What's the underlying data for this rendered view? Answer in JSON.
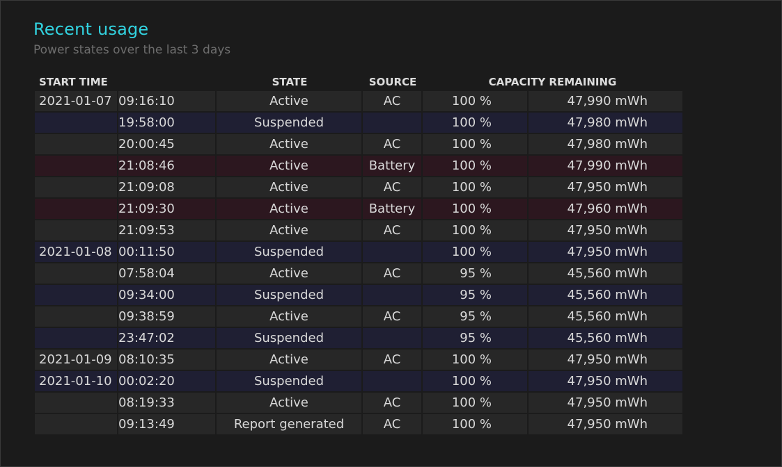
{
  "header": {
    "title": "Recent usage",
    "subtitle": "Power states over the last 3 days"
  },
  "columns": {
    "start_time": "START TIME",
    "state": "STATE",
    "source": "SOURCE",
    "capacity": "CAPACITY REMAINING"
  },
  "colors": {
    "title": "#32d3e0",
    "row_ac": "#272727",
    "row_suspended": "#1f1f33",
    "row_battery": "#2c171f"
  },
  "rows": [
    {
      "date": "2021-01-07",
      "time": "09:16:10",
      "state": "Active",
      "source": "AC",
      "percent": "100 %",
      "mwh": "47,990 mWh"
    },
    {
      "date": "",
      "time": "19:58:00",
      "state": "Suspended",
      "source": "",
      "percent": "100 %",
      "mwh": "47,980 mWh"
    },
    {
      "date": "",
      "time": "20:00:45",
      "state": "Active",
      "source": "AC",
      "percent": "100 %",
      "mwh": "47,980 mWh"
    },
    {
      "date": "",
      "time": "21:08:46",
      "state": "Active",
      "source": "Battery",
      "percent": "100 %",
      "mwh": "47,990 mWh"
    },
    {
      "date": "",
      "time": "21:09:08",
      "state": "Active",
      "source": "AC",
      "percent": "100 %",
      "mwh": "47,950 mWh"
    },
    {
      "date": "",
      "time": "21:09:30",
      "state": "Active",
      "source": "Battery",
      "percent": "100 %",
      "mwh": "47,960 mWh"
    },
    {
      "date": "",
      "time": "21:09:53",
      "state": "Active",
      "source": "AC",
      "percent": "100 %",
      "mwh": "47,950 mWh"
    },
    {
      "date": "2021-01-08",
      "time": "00:11:50",
      "state": "Suspended",
      "source": "",
      "percent": "100 %",
      "mwh": "47,950 mWh"
    },
    {
      "date": "",
      "time": "07:58:04",
      "state": "Active",
      "source": "AC",
      "percent": "95 %",
      "mwh": "45,560 mWh"
    },
    {
      "date": "",
      "time": "09:34:00",
      "state": "Suspended",
      "source": "",
      "percent": "95 %",
      "mwh": "45,560 mWh"
    },
    {
      "date": "",
      "time": "09:38:59",
      "state": "Active",
      "source": "AC",
      "percent": "95 %",
      "mwh": "45,560 mWh"
    },
    {
      "date": "",
      "time": "23:47:02",
      "state": "Suspended",
      "source": "",
      "percent": "95 %",
      "mwh": "45,560 mWh"
    },
    {
      "date": "2021-01-09",
      "time": "08:10:35",
      "state": "Active",
      "source": "AC",
      "percent": "100 %",
      "mwh": "47,950 mWh"
    },
    {
      "date": "2021-01-10",
      "time": "00:02:20",
      "state": "Suspended",
      "source": "",
      "percent": "100 %",
      "mwh": "47,950 mWh"
    },
    {
      "date": "",
      "time": "08:19:33",
      "state": "Active",
      "source": "AC",
      "percent": "100 %",
      "mwh": "47,950 mWh"
    },
    {
      "date": "",
      "time": "09:13:49",
      "state": "Report generated",
      "source": "AC",
      "percent": "100 %",
      "mwh": "47,950 mWh"
    }
  ]
}
